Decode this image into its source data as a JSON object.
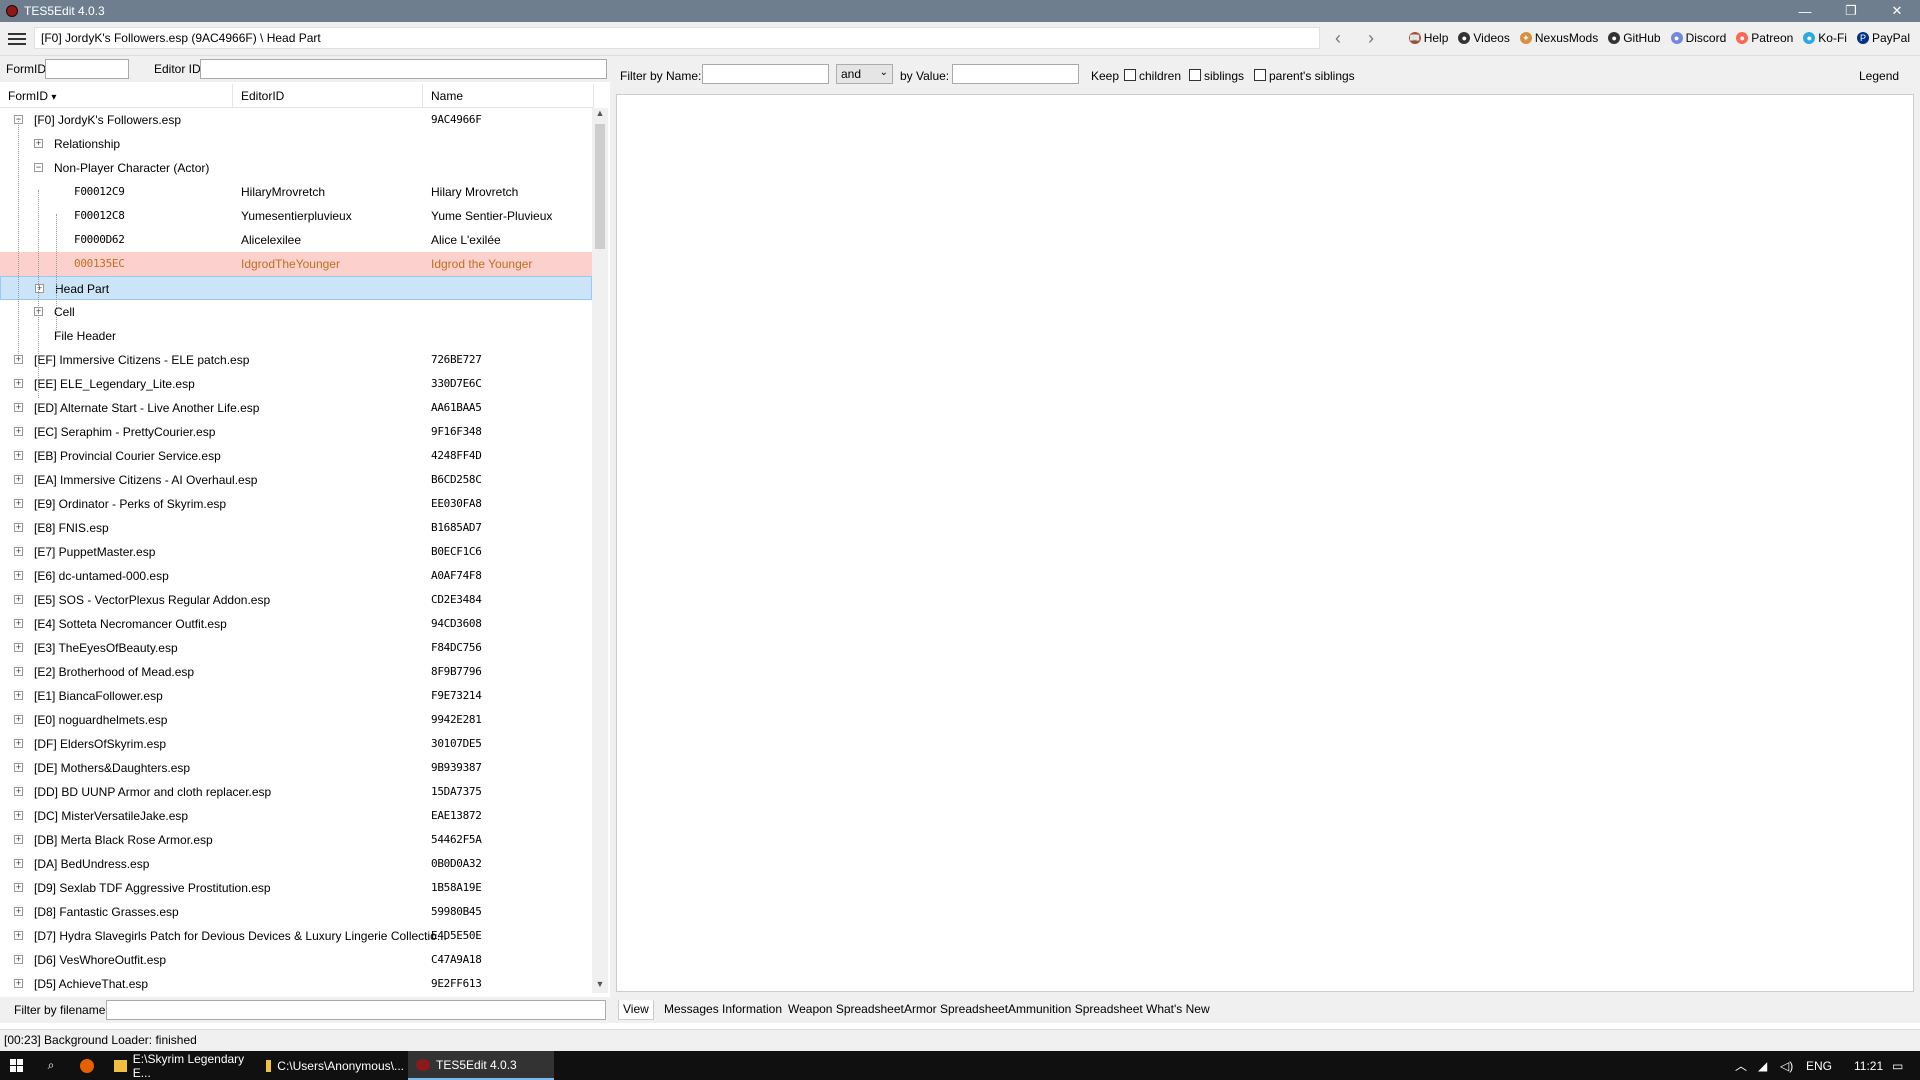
{
  "window": {
    "title": "TES5Edit 4.0.3",
    "controls": {
      "minimize": "—",
      "maximize": "❐",
      "close": "✕"
    }
  },
  "toolbar": {
    "path": "[F0] JordyK's Followers.esp (9AC4966F) \\ Head Part",
    "back": "‹",
    "forward": "›",
    "links": [
      {
        "label": "Help",
        "icon": "book-icon",
        "glyph": "📖",
        "color": "#a0522d"
      },
      {
        "label": "Videos",
        "icon": "video-icon",
        "glyph": "●",
        "color": "#333333"
      },
      {
        "label": "NexusMods",
        "icon": "nexusmods-icon",
        "glyph": "✦",
        "color": "#d98f40"
      },
      {
        "label": "GitHub",
        "icon": "github-icon",
        "glyph": "●",
        "color": "#333333"
      },
      {
        "label": "Discord",
        "icon": "discord-icon",
        "glyph": "●",
        "color": "#7289da"
      },
      {
        "label": "Patreon",
        "icon": "patreon-icon",
        "glyph": "●",
        "color": "#f96854"
      },
      {
        "label": "Ko-Fi",
        "icon": "kofi-icon",
        "glyph": "●",
        "color": "#29abe0"
      },
      {
        "label": "PayPal",
        "icon": "paypal-icon",
        "glyph": "P",
        "color": "#003087"
      }
    ]
  },
  "search": {
    "formid_label": "FormID",
    "formid_value": "",
    "editorid_label": "Editor ID",
    "editorid_value": ""
  },
  "tree": {
    "columns": {
      "formid": "FormID",
      "editorid": "EditorID",
      "name": "Name"
    },
    "sort_arrow": "▾",
    "rows": [
      {
        "level": 0,
        "exp": "−",
        "label": "[F0] JordyK's Followers.esp",
        "editorid": "",
        "name": "9AC4966F",
        "mono": true
      },
      {
        "level": 1,
        "exp": "+",
        "label": "Relationship",
        "editorid": "",
        "name": "",
        "mono": false
      },
      {
        "level": 1,
        "exp": "−",
        "label": "Non-Player Character (Actor)",
        "editorid": "",
        "name": "",
        "mono": false
      },
      {
        "level": 2,
        "exp": "",
        "label": "F00012C9",
        "editorid": "HilaryMrovretch",
        "name": "Hilary Mrovretch",
        "mono": false,
        "fid": true
      },
      {
        "level": 2,
        "exp": "",
        "label": "F00012C8",
        "editorid": "Yumesentierpluvieux",
        "name": "Yume Sentier-Pluvieux",
        "mono": false,
        "fid": true
      },
      {
        "level": 2,
        "exp": "",
        "label": "F0000D62",
        "editorid": "Alicelexilee",
        "name": "Alice L'exilée",
        "mono": false,
        "fid": true
      },
      {
        "level": 2,
        "exp": "",
        "label": "000135EC",
        "editorid": "IdgrodTheYounger",
        "name": "Idgrod the Younger",
        "mono": false,
        "fid": true,
        "hl": true
      },
      {
        "level": 1,
        "exp": "+",
        "label": "Head Part",
        "editorid": "",
        "name": "",
        "mono": false,
        "sel": true
      },
      {
        "level": 1,
        "exp": "+",
        "label": "Cell",
        "editorid": "",
        "name": "",
        "mono": false
      },
      {
        "level": 1,
        "exp": "",
        "label": "File Header",
        "editorid": "",
        "name": "",
        "mono": false
      },
      {
        "level": 0,
        "exp": "+",
        "label": "[EF] Immersive Citizens - ELE patch.esp",
        "editorid": "",
        "name": "726BE727",
        "mono": true
      },
      {
        "level": 0,
        "exp": "+",
        "label": "[EE] ELE_Legendary_Lite.esp",
        "editorid": "",
        "name": "330D7E6C",
        "mono": true
      },
      {
        "level": 0,
        "exp": "+",
        "label": "[ED] Alternate Start - Live Another Life.esp",
        "editorid": "",
        "name": "AA61BAA5",
        "mono": true
      },
      {
        "level": 0,
        "exp": "+",
        "label": "[EC] Seraphim - PrettyCourier.esp",
        "editorid": "",
        "name": "9F16F348",
        "mono": true
      },
      {
        "level": 0,
        "exp": "+",
        "label": "[EB] Provincial Courier Service.esp",
        "editorid": "",
        "name": "4248FF4D",
        "mono": true
      },
      {
        "level": 0,
        "exp": "+",
        "label": "[EA] Immersive Citizens - AI Overhaul.esp",
        "editorid": "",
        "name": "B6CD258C",
        "mono": true
      },
      {
        "level": 0,
        "exp": "+",
        "label": "[E9] Ordinator - Perks of Skyrim.esp",
        "editorid": "",
        "name": "EE030FA8",
        "mono": true
      },
      {
        "level": 0,
        "exp": "+",
        "label": "[E8] FNIS.esp",
        "editorid": "",
        "name": "B1685AD7",
        "mono": true
      },
      {
        "level": 0,
        "exp": "+",
        "label": "[E7] PuppetMaster.esp",
        "editorid": "",
        "name": "B0ECF1C6",
        "mono": true
      },
      {
        "level": 0,
        "exp": "+",
        "label": "[E6] dc-untamed-000.esp",
        "editorid": "",
        "name": "A0AF74F8",
        "mono": true
      },
      {
        "level": 0,
        "exp": "+",
        "label": "[E5] SOS - VectorPlexus Regular Addon.esp",
        "editorid": "",
        "name": "CD2E3484",
        "mono": true
      },
      {
        "level": 0,
        "exp": "+",
        "label": "[E4] Sotteta Necromancer Outfit.esp",
        "editorid": "",
        "name": "94CD3608",
        "mono": true
      },
      {
        "level": 0,
        "exp": "+",
        "label": "[E3] TheEyesOfBeauty.esp",
        "editorid": "",
        "name": "F84DC756",
        "mono": true
      },
      {
        "level": 0,
        "exp": "+",
        "label": "[E2] Brotherhood of Mead.esp",
        "editorid": "",
        "name": "8F9B7796",
        "mono": true
      },
      {
        "level": 0,
        "exp": "+",
        "label": "[E1] BiancaFollower.esp",
        "editorid": "",
        "name": "F9E73214",
        "mono": true
      },
      {
        "level": 0,
        "exp": "+",
        "label": "[E0] noguardhelmets.esp",
        "editorid": "",
        "name": "9942E281",
        "mono": true
      },
      {
        "level": 0,
        "exp": "+",
        "label": "[DF] EldersOfSkyrim.esp",
        "editorid": "",
        "name": "30107DE5",
        "mono": true
      },
      {
        "level": 0,
        "exp": "+",
        "label": "[DE] Mothers&Daughters.esp",
        "editorid": "",
        "name": "9B939387",
        "mono": true
      },
      {
        "level": 0,
        "exp": "+",
        "label": "[DD] BD UUNP Armor and cloth replacer.esp",
        "editorid": "",
        "name": "15DA7375",
        "mono": true
      },
      {
        "level": 0,
        "exp": "+",
        "label": "[DC] MisterVersatileJake.esp",
        "editorid": "",
        "name": "EAE13872",
        "mono": true
      },
      {
        "level": 0,
        "exp": "+",
        "label": "[DB] Merta Black Rose Armor.esp",
        "editorid": "",
        "name": "54462F5A",
        "mono": true
      },
      {
        "level": 0,
        "exp": "+",
        "label": "[DA] BedUndress.esp",
        "editorid": "",
        "name": "0B0D0A32",
        "mono": true
      },
      {
        "level": 0,
        "exp": "+",
        "label": "[D9] Sexlab TDF Aggressive Prostitution.esp",
        "editorid": "",
        "name": "1B58A19E",
        "mono": true
      },
      {
        "level": 0,
        "exp": "+",
        "label": "[D8] Fantastic Grasses.esp",
        "editorid": "",
        "name": "59980B45",
        "mono": true
      },
      {
        "level": 0,
        "exp": "+",
        "label": "[D7] Hydra Slavegirls Patch for Devious Devices & Luxury Lingerie Collectio...",
        "editorid": "",
        "name": "E4D5E50E",
        "mono": true
      },
      {
        "level": 0,
        "exp": "+",
        "label": "[D6] VesWhoreOutfit.esp",
        "editorid": "",
        "name": "C47A9A18",
        "mono": true
      },
      {
        "level": 0,
        "exp": "+",
        "label": "[D5] AchieveThat.esp",
        "editorid": "",
        "name": "9E2FF613",
        "mono": true
      }
    ]
  },
  "filename_filter": {
    "label": "Filter by filename:",
    "value": ""
  },
  "filter": {
    "by_name_label": "Filter by Name:",
    "name_value": "",
    "operator": "and",
    "by_value_label": "by Value:",
    "value_value": "",
    "keep_label": "Keep",
    "children_label": "children",
    "siblings_label": "siblings",
    "parents_siblings_label": "parent's siblings",
    "legend_label": "Legend"
  },
  "tabs": [
    "View",
    "Messages",
    "Information",
    "Weapon Spreadsheet",
    "Armor Spreadsheet",
    "Ammunition Spreadsheet",
    "What's New"
  ],
  "status": "[00:23] Background Loader: finished",
  "taskbar": {
    "items": [
      {
        "label": "E:\\Skyrim Legendary E...",
        "icon": "folder-icon"
      },
      {
        "label": "C:\\Users\\Anonymous\\...",
        "icon": "folder-icon"
      },
      {
        "label": "TES5Edit 4.0.3",
        "icon": "tes5edit-icon"
      }
    ],
    "lang": "ENG",
    "time": "11:21"
  }
}
